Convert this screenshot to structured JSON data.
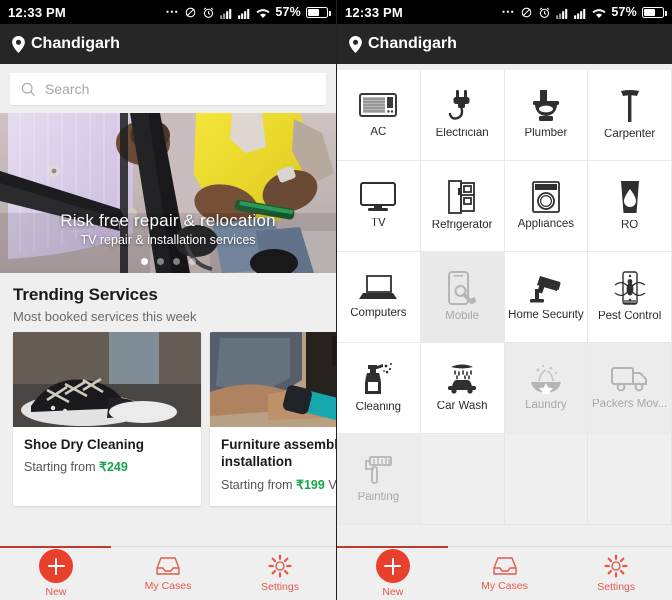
{
  "status_bar": {
    "time": "12:33 PM",
    "battery_percent": "57%",
    "icons": [
      "more-dots-icon",
      "mute-vibrate-icon",
      "alarm-icon",
      "signal-1-icon",
      "signal-2-icon",
      "wifi-icon",
      "battery-icon"
    ]
  },
  "app_bar": {
    "location": "Chandigarh",
    "location_icon": "map-pin-icon"
  },
  "search": {
    "placeholder": "Search",
    "value": "",
    "icon": "search-icon"
  },
  "hero": {
    "title": "Risk free repair & relocation",
    "subtitle": "TV repair & installation services",
    "dots_total": 4,
    "dot_active_index": 0
  },
  "trending": {
    "heading": "Trending Services",
    "subheading": "Most booked services this week",
    "cards": [
      {
        "title": "Shoe Dry Cleaning",
        "price_prefix": "Starting from ",
        "price": "₹249",
        "price_suffix": ""
      },
      {
        "title": "Furniture assembly and installation",
        "price_prefix": "Starting from ",
        "price": "₹199",
        "price_suffix": " Visit c"
      }
    ]
  },
  "categories": [
    {
      "label": "AC",
      "icon": "air-conditioner-icon",
      "state": "normal"
    },
    {
      "label": "Electrician",
      "icon": "plug-icon",
      "state": "normal"
    },
    {
      "label": "Plumber",
      "icon": "toilet-icon",
      "state": "normal"
    },
    {
      "label": "Carpenter",
      "icon": "hammer-icon",
      "state": "normal"
    },
    {
      "label": "TV",
      "icon": "television-icon",
      "state": "normal"
    },
    {
      "label": "Refrigerator",
      "icon": "refrigerator-icon",
      "state": "normal"
    },
    {
      "label": "Appliances",
      "icon": "washing-machine-icon",
      "state": "normal"
    },
    {
      "label": "RO",
      "icon": "water-glass-icon",
      "state": "normal"
    },
    {
      "label": "Computers",
      "icon": "laptop-icon",
      "state": "normal"
    },
    {
      "label": "Mobile",
      "icon": "mobile-repair-icon",
      "state": "pressed"
    },
    {
      "label": "Home Security",
      "icon": "cctv-camera-icon",
      "state": "normal"
    },
    {
      "label": "Pest Control",
      "icon": "pest-icon",
      "state": "normal"
    },
    {
      "label": "Cleaning",
      "icon": "spray-bottle-icon",
      "state": "normal"
    },
    {
      "label": "Car Wash",
      "icon": "car-wash-icon",
      "state": "normal"
    },
    {
      "label": "Laundry",
      "icon": "laundry-icon",
      "state": "disabled"
    },
    {
      "label": "Packers Mov...",
      "icon": "moving-truck-icon",
      "state": "disabled"
    },
    {
      "label": "Painting",
      "icon": "paint-roller-icon",
      "state": "disabled"
    }
  ],
  "bottom_nav": {
    "progress_percent": 33,
    "items": [
      {
        "label": "New",
        "icon": "plus-fab-icon",
        "active": true
      },
      {
        "label": "My Cases",
        "icon": "inbox-icon",
        "active": false
      },
      {
        "label": "Settings",
        "icon": "gear-icon",
        "active": false
      }
    ]
  },
  "colors": {
    "accent_red": "#e8402c",
    "nav_label": "#e2584a",
    "price_green": "#15a64a",
    "appbar_bg": "#262626",
    "page_bg": "#efefef"
  }
}
